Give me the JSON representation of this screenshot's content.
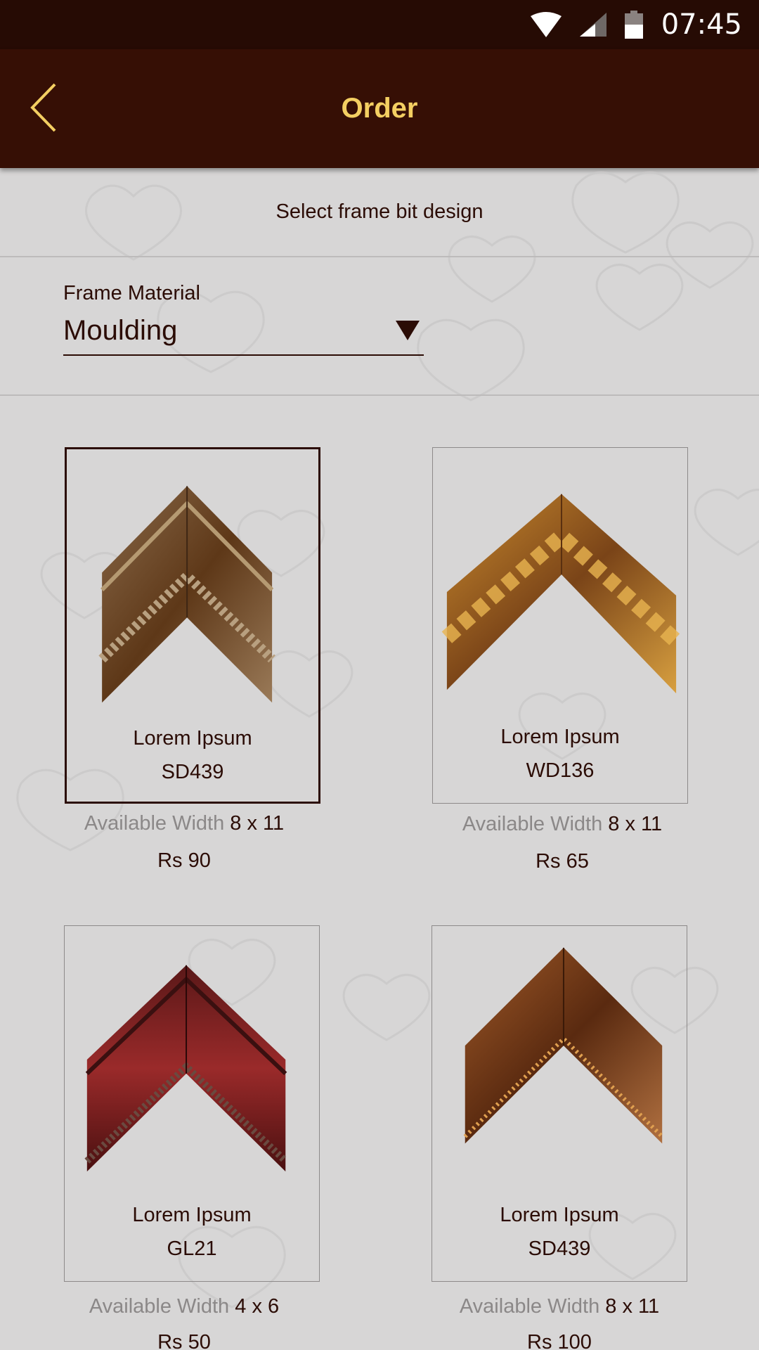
{
  "status_bar": {
    "time": "07:45",
    "icons": [
      "wifi-icon",
      "signal-icon",
      "battery-icon"
    ]
  },
  "app_bar": {
    "title": "Order",
    "back_icon": "chevron-left-icon"
  },
  "subheader": "Select frame bit design",
  "material": {
    "label": "Frame Material",
    "value": "Moulding",
    "dropdown_icon": "triangle-down-icon"
  },
  "products": [
    {
      "name": "Lorem Ipsum",
      "code": "SD439",
      "width_label": "Available Width",
      "width": "8 x 11",
      "price": "Rs 90",
      "selected": true
    },
    {
      "name": "Lorem Ipsum",
      "code": "WD136",
      "width_label": "Available Width",
      "width": "8 x 11",
      "price": "Rs 65",
      "selected": false
    },
    {
      "name": "Lorem Ipsum",
      "code": "GL21",
      "width_label": "Available Width",
      "width": "4 x 6",
      "price": "Rs 50",
      "selected": false
    },
    {
      "name": "Lorem Ipsum",
      "code": "SD439",
      "width_label": "Available Width",
      "width": "8 x 11",
      "price": "Rs 100",
      "selected": false
    }
  ],
  "colors": {
    "status_bar": "#260b04",
    "app_bar": "#360f05",
    "title_gold": "#f4cf62",
    "text_dark": "#2b0c05",
    "muted": "#8b8888",
    "background": "#d7d6d6"
  }
}
